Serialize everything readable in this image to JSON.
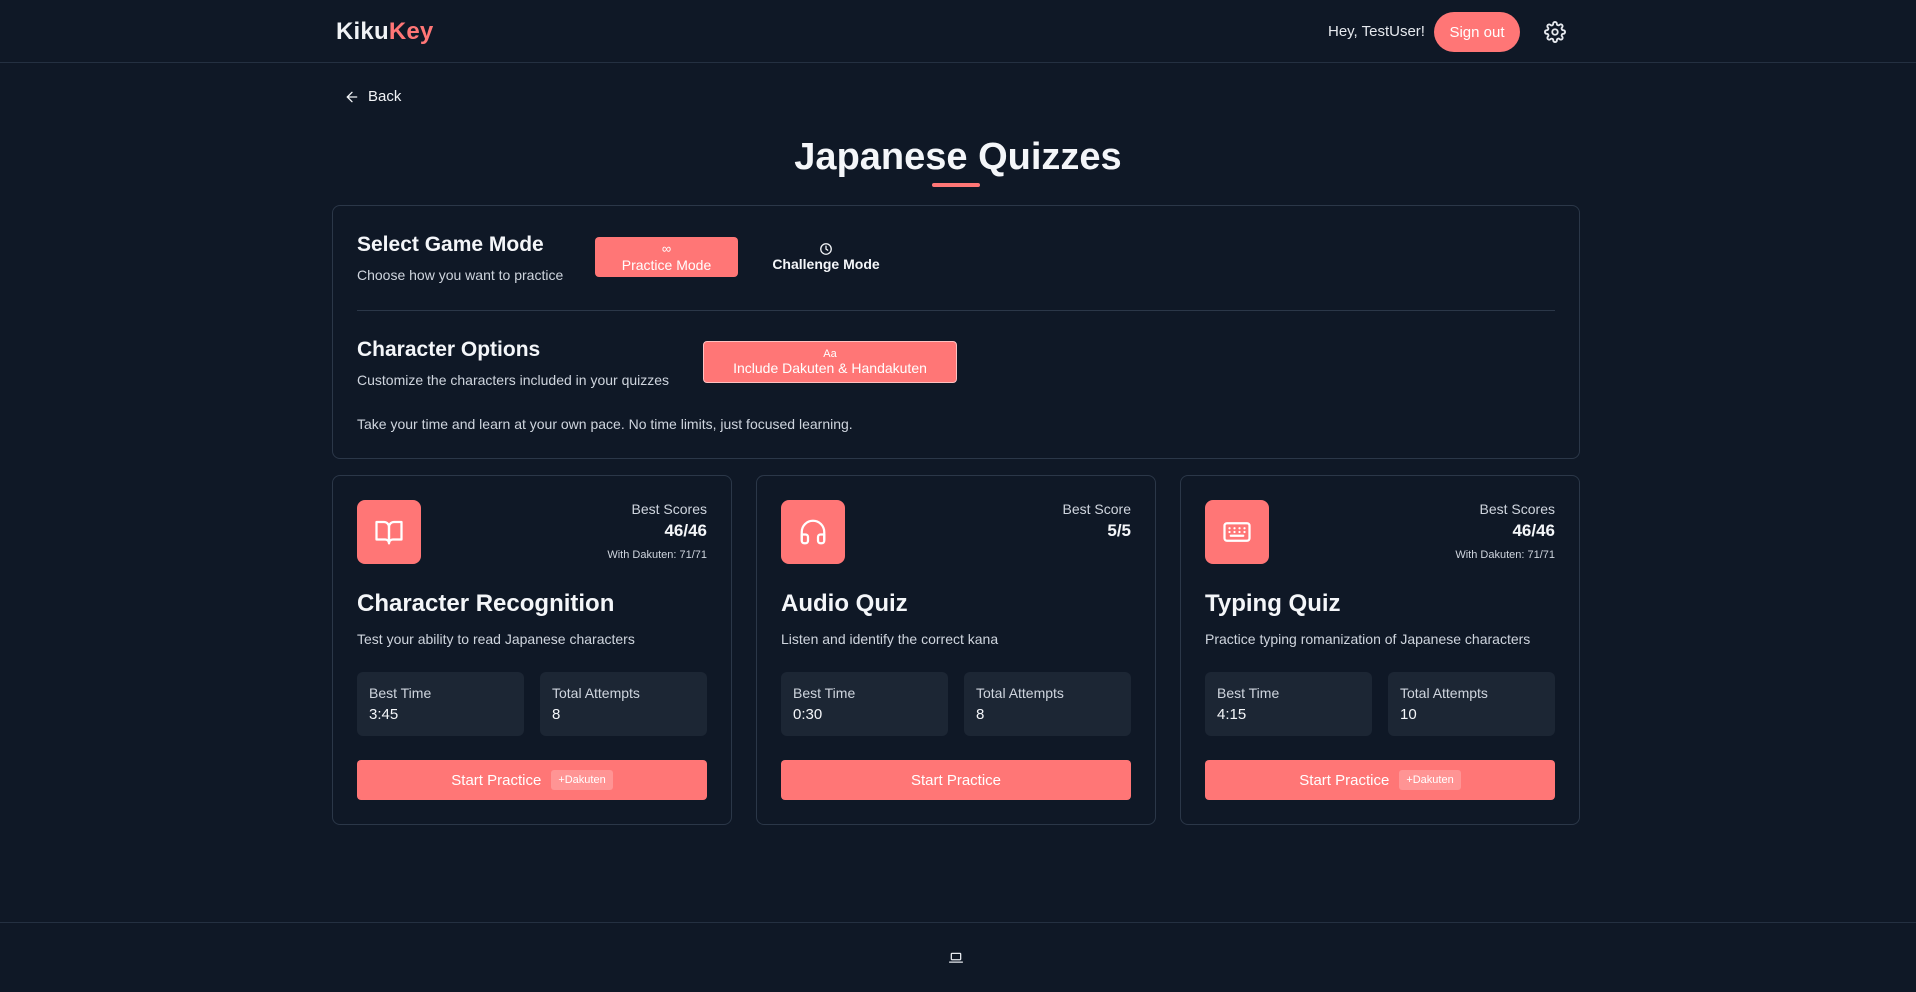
{
  "header": {
    "logo_part1": "Kiku",
    "logo_part2": "Key",
    "greeting": "Hey, TestUser!",
    "signout_label": "Sign out",
    "settings_icon": "gear-icon",
    "accent_color": "#ff7676"
  },
  "nav": {
    "back_label": "Back"
  },
  "page": {
    "title": "Japanese Quizzes"
  },
  "game_mode": {
    "heading": "Select Game Mode",
    "subtitle": "Choose how you want to practice",
    "modes": [
      {
        "label": "Practice Mode",
        "icon": "∞",
        "selected": true
      },
      {
        "label": "Challenge Mode",
        "icon": "clock-icon",
        "selected": false
      }
    ]
  },
  "character_options": {
    "heading": "Character Options",
    "subtitle": "Customize the characters included in your quizzes",
    "toggle_icon": "Aa",
    "toggle_label": "Include Dakuten & Handakuten",
    "toggle_active": true,
    "info": "Take your time and learn at your own pace. No time limits, just focused learning."
  },
  "quizzes": [
    {
      "icon": "book-icon",
      "score_label": "Best Scores",
      "score": "46/46",
      "dakuten_score": "With Dakuten: 71/71",
      "title": "Character Recognition",
      "description": "Test your ability to read Japanese characters",
      "best_time_label": "Best Time",
      "best_time": "3:45",
      "attempts_label": "Total Attempts",
      "attempts": "8",
      "button_label": "Start Practice",
      "button_tag": "+Dakuten"
    },
    {
      "icon": "headphones-icon",
      "score_label": "Best Score",
      "score": "5/5",
      "title": "Audio Quiz",
      "description": "Listen and identify the correct kana",
      "best_time_label": "Best Time",
      "best_time": "0:30",
      "attempts_label": "Total Attempts",
      "attempts": "8",
      "button_label": "Start Practice"
    },
    {
      "icon": "keyboard-icon",
      "score_label": "Best Scores",
      "score": "46/46",
      "dakuten_score": "With Dakuten: 71/71",
      "title": "Typing Quiz",
      "description": "Practice typing romanization of Japanese characters",
      "best_time_label": "Best Time",
      "best_time": "4:15",
      "attempts_label": "Total Attempts",
      "attempts": "10",
      "button_label": "Start Practice",
      "button_tag": "+Dakuten"
    }
  ],
  "footer": {
    "icon": "laptop-icon"
  }
}
